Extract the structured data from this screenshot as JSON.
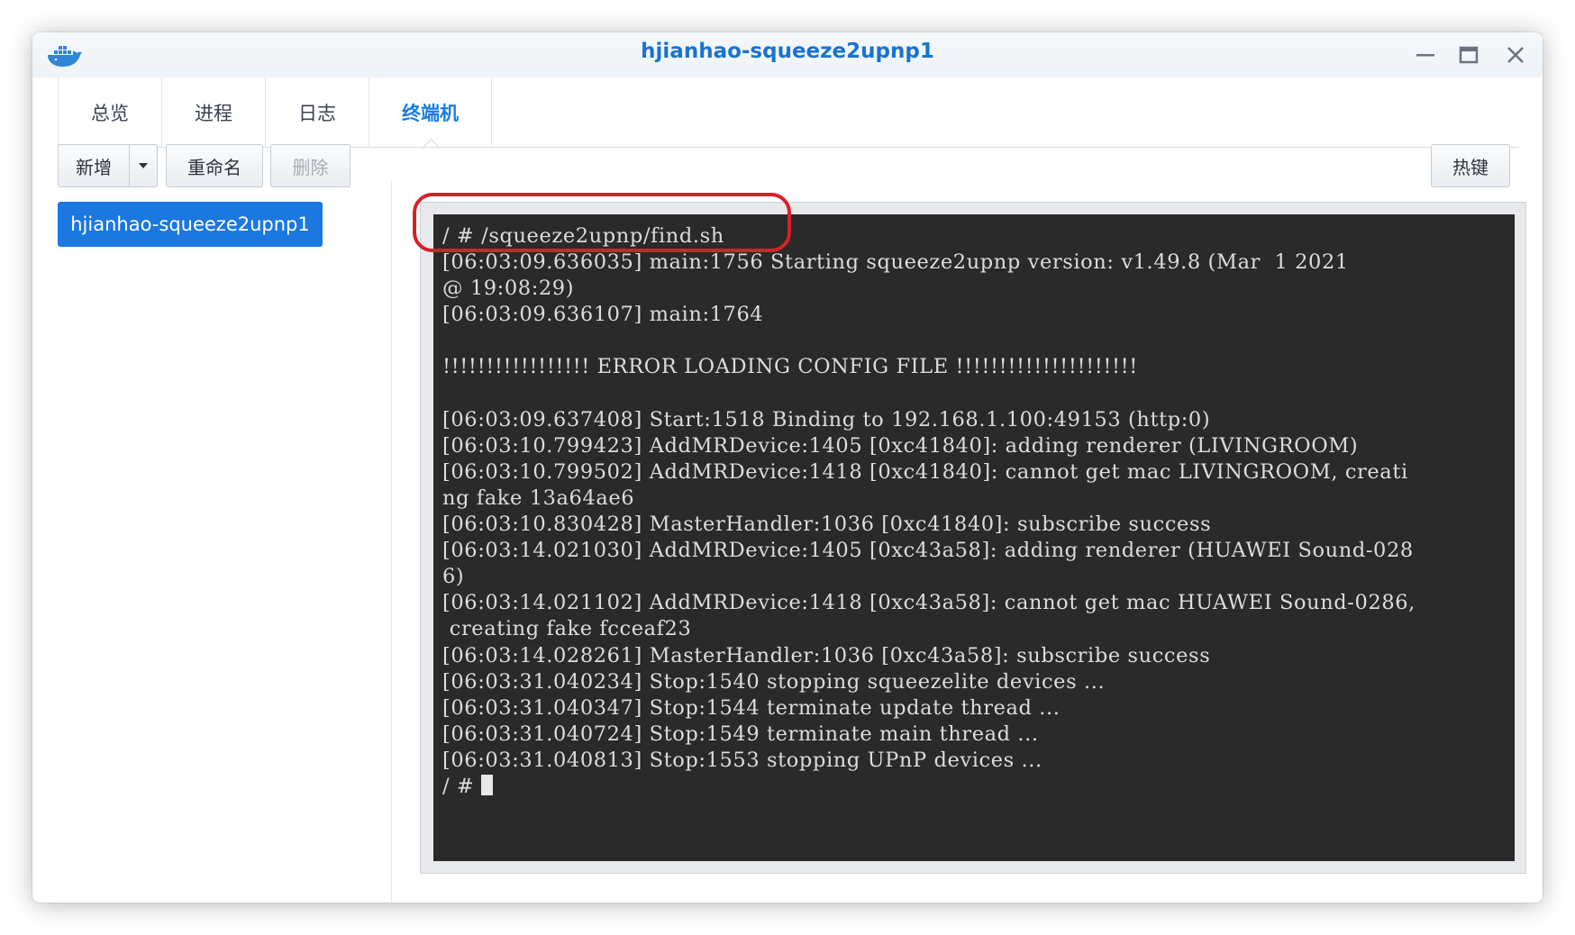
{
  "window": {
    "title": "hjianhao-squeeze2upnp1",
    "logo_icon": "docker-whale-icon",
    "controls": [
      "minimize-icon",
      "maximize-icon",
      "close-icon"
    ]
  },
  "tabs": [
    {
      "label": "总览",
      "active": false
    },
    {
      "label": "进程",
      "active": false
    },
    {
      "label": "日志",
      "active": false
    },
    {
      "label": "终端机",
      "active": true
    }
  ],
  "toolbar": {
    "add_label": "新增",
    "rename_label": "重命名",
    "delete_label": "删除",
    "hotkey_label": "热键"
  },
  "sidebar": {
    "items": [
      {
        "label": "hjianhao-squeeze2upnp1",
        "selected": true
      }
    ]
  },
  "terminal": {
    "lines": [
      "/ # /squeeze2upnp/find.sh",
      "[06:03:09.636035] main:1756 Starting squeeze2upnp version: v1.49.8 (Mar  1 2021",
      "@ 19:08:29)",
      "[06:03:09.636107] main:1764",
      "",
      "!!!!!!!!!!!!!!!!! ERROR LOADING CONFIG FILE !!!!!!!!!!!!!!!!!!!!!",
      "",
      "[06:03:09.637408] Start:1518 Binding to 192.168.1.100:49153 (http:0)",
      "[06:03:10.799423] AddMRDevice:1405 [0xc41840]: adding renderer (LIVINGROOM)",
      "[06:03:10.799502] AddMRDevice:1418 [0xc41840]: cannot get mac LIVINGROOM, creati",
      "ng fake 13a64ae6",
      "[06:03:10.830428] MasterHandler:1036 [0xc41840]: subscribe success",
      "[06:03:14.021030] AddMRDevice:1405 [0xc43a58]: adding renderer (HUAWEI Sound-028",
      "6)",
      "[06:03:14.021102] AddMRDevice:1418 [0xc43a58]: cannot get mac HUAWEI Sound-0286,",
      " creating fake fcceaf23",
      "[06:03:14.028261] MasterHandler:1036 [0xc43a58]: subscribe success",
      "[06:03:31.040234] Stop:1540 stopping squeezelite devices ...",
      "[06:03:31.040347] Stop:1544 terminate update thread ...",
      "[06:03:31.040724] Stop:1549 terminate main thread ...",
      "[06:03:31.040813] Stop:1553 stopping UPnP devices ..."
    ],
    "prompt": "/ # ",
    "colors": {
      "background": "#2a2a2a",
      "text": "#dcdcdc"
    }
  },
  "annotation": {
    "color": "#d7202a"
  }
}
